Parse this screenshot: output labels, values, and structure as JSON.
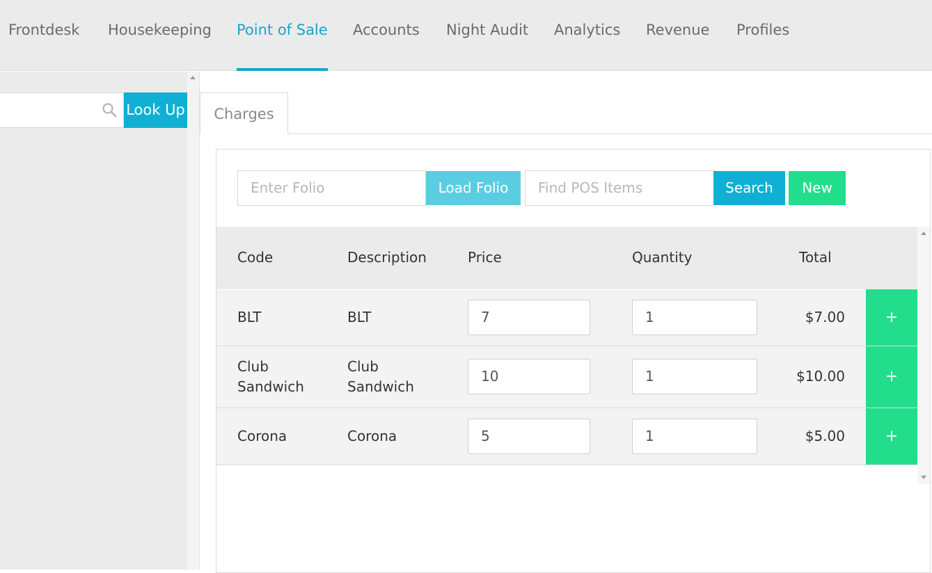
{
  "nav": {
    "items": [
      {
        "label": "Frontdesk"
      },
      {
        "label": "Housekeeping"
      },
      {
        "label": "Point of Sale"
      },
      {
        "label": "Accounts"
      },
      {
        "label": "Night Audit"
      },
      {
        "label": "Analytics"
      },
      {
        "label": "Revenue"
      },
      {
        "label": "Profiles"
      }
    ],
    "active": "Point of Sale",
    "accent_color": "#17a5c9"
  },
  "sidebar": {
    "search_icon": "search-icon",
    "lookup_label": "Look Up"
  },
  "tabs": [
    {
      "label": "Charges"
    }
  ],
  "toolbar": {
    "folio_placeholder": "Enter Folio",
    "load_folio_label": "Load Folio",
    "find_placeholder": "Find POS Items",
    "search_label": "Search",
    "new_label": "New"
  },
  "table": {
    "headers": {
      "code": "Code",
      "description": "Description",
      "price": "Price",
      "quantity": "Quantity",
      "total": "Total"
    },
    "rows": [
      {
        "code": "BLT",
        "description": "BLT",
        "price": "7",
        "quantity": "1",
        "total": "$7.00",
        "add": "+"
      },
      {
        "code": "Club Sandwich",
        "description": "Club Sandwich",
        "price": "10",
        "quantity": "1",
        "total": "$10.00",
        "add": "+"
      },
      {
        "code": "Corona",
        "description": "Corona",
        "price": "5",
        "quantity": "1",
        "total": "$5.00",
        "add": "+"
      }
    ]
  },
  "colors": {
    "primary": "#0fb0d3",
    "load_folio": "#5bcde2",
    "success": "#22dd8c"
  }
}
